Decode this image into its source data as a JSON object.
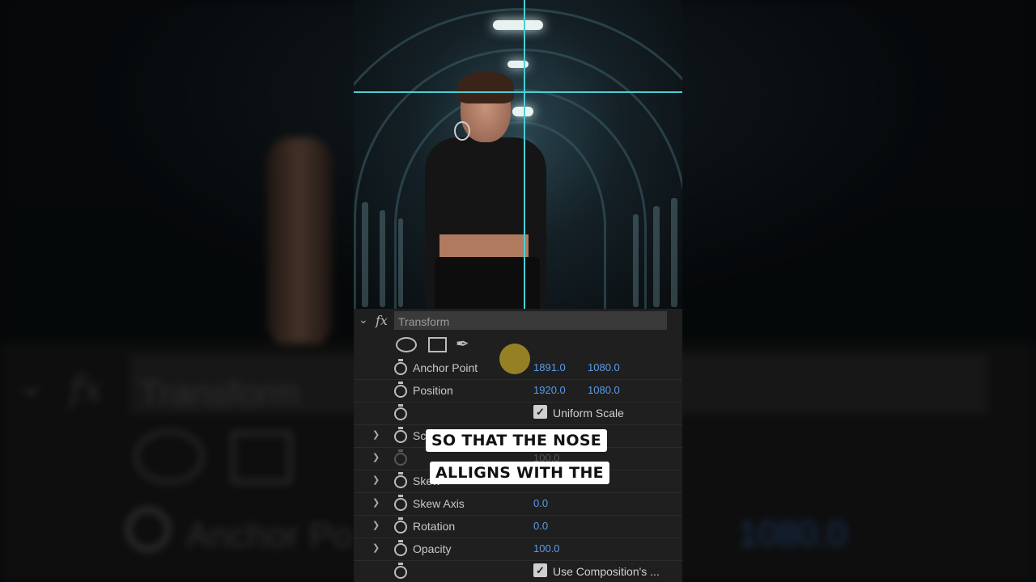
{
  "background_zoom": {
    "title": "Transform",
    "anchor_value_y": "1080.0",
    "anchor_label": "Anchor Po"
  },
  "effect": {
    "name": "Transform",
    "fx_label": "fx",
    "expand_icon": "chevron-down-icon"
  },
  "properties": [
    {
      "label": "Anchor Point",
      "x": "1891.0",
      "y": "1080.0"
    },
    {
      "label": "Position",
      "x": "1920.0",
      "y": "1080.0"
    },
    {
      "label": "Uniform Scale"
    },
    {
      "label": "Sc"
    },
    {
      "label": "",
      "value": "100.0"
    },
    {
      "label": "Skew"
    },
    {
      "label": "Skew Axis",
      "value": "0.0"
    },
    {
      "label": "Rotation",
      "value": "0.0"
    },
    {
      "label": "Opacity",
      "value": "100.0"
    },
    {
      "label": "Use Composition's ..."
    }
  ],
  "captions": [
    "SO THAT THE NOSE",
    "ALLIGNS WITH THE"
  ],
  "colors": {
    "value_blue": "#5b9be6",
    "guide_cyan": "#4ccfd6",
    "cursor_yellow": "#c8aa28",
    "panel_bg": "#1f1f1f"
  }
}
